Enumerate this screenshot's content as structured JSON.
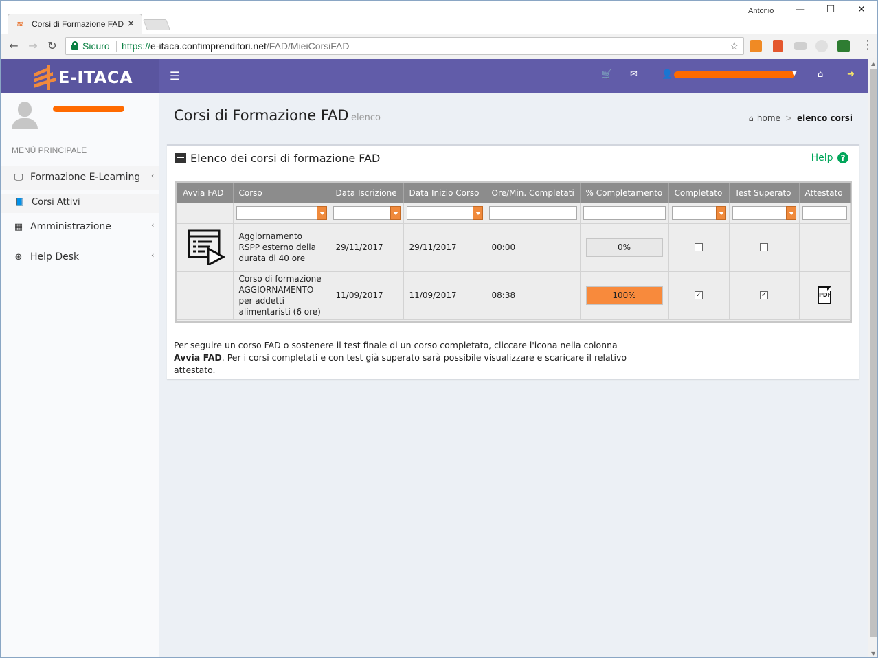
{
  "browser": {
    "tab_title": "Corsi di Formazione FAD",
    "tab_close": "×",
    "window_user": "Antonio",
    "minimize": "—",
    "maximize": "☐",
    "close": "✕",
    "secure_label": "Sicuro",
    "url_scheme": "https://",
    "url_host": "e-itaca.confimprenditori.net",
    "url_path": "/FAD/MieiCorsiFAD"
  },
  "app": {
    "logo": "E-ITACA",
    "brand_color": "#615ca9",
    "accent_color": "#f88a3c"
  },
  "sidebar": {
    "menu_header": "MENÙ PRINCIPALE",
    "items": [
      {
        "label": "Formazione E-Learning",
        "icon": "monitor-icon"
      },
      {
        "label": "Corsi Attivi",
        "icon": "book-icon"
      },
      {
        "label": "Amministrazione",
        "icon": "table-icon"
      },
      {
        "label": "Help Desk",
        "icon": "life-ring-icon"
      }
    ]
  },
  "page": {
    "title": "Corsi di Formazione FAD",
    "subtitle": "elenco",
    "breadcrumb_home": "home",
    "breadcrumb_active": "elenco corsi"
  },
  "box": {
    "title": "Elenco dei corsi di formazione FAD",
    "help": "Help",
    "note_part1": "Per seguire un corso FAD o sostenere il test finale di un corso completato, cliccare l'icona nella colonna ",
    "note_bold": "Avvia FAD",
    "note_part2": ". Per i corsi completati e con test già superato sarà possibile visualizzare e scaricare il relativo attestato."
  },
  "grid": {
    "columns": [
      "Avvia FAD",
      "Corso",
      "Data Iscrizione",
      "Data Inizio Corso",
      "Ore/Min. Completati",
      "% Completamento",
      "Completato",
      "Test Superato",
      "Attestato"
    ],
    "rows": [
      {
        "corso": "Aggiornamento RSPP esterno della durata di 40 ore",
        "data_iscrizione": "29/11/2017",
        "data_inizio": "29/11/2017",
        "ore": "00:00",
        "percent": "0%",
        "percent_value": 0,
        "completato": false,
        "test_superato": false,
        "attestato": ""
      },
      {
        "corso": "Corso di formazione AGGIORNAMENTO per addetti alimentaristi (6 ore)",
        "data_iscrizione": "11/09/2017",
        "data_inizio": "11/09/2017",
        "ore": "08:38",
        "percent": "100%",
        "percent_value": 100,
        "completato": true,
        "test_superato": true,
        "attestato": "PDF"
      }
    ]
  }
}
